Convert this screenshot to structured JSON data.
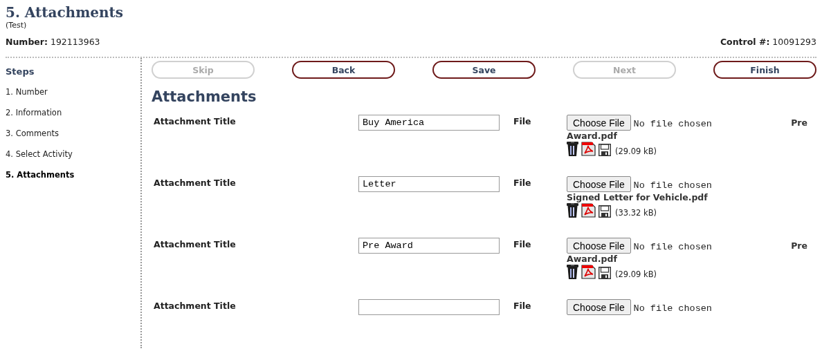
{
  "header": {
    "title": "5. Attachments",
    "subtitle": "(Test)",
    "number_label": "Number:",
    "number": "192113963",
    "control_label": "Control #:",
    "control": "10091293"
  },
  "steps": {
    "heading": "Steps",
    "items": [
      {
        "label": "1. Number",
        "selected": false
      },
      {
        "label": "2. Information",
        "selected": false
      },
      {
        "label": "3. Comments",
        "selected": false
      },
      {
        "label": "4. Select Activity",
        "selected": false
      },
      {
        "label": "5. Attachments",
        "selected": true
      }
    ]
  },
  "buttons": [
    {
      "label": "Skip",
      "disabled": true
    },
    {
      "label": "Back",
      "disabled": false
    },
    {
      "label": "Save",
      "disabled": false
    },
    {
      "label": "Next",
      "disabled": true
    },
    {
      "label": "Finish",
      "disabled": false
    }
  ],
  "section_title": "Attachments",
  "attachments": [
    {
      "title_label": "Attachment Title",
      "value": "Buy America",
      "file_label": "File",
      "choose_label": "Choose File",
      "no_file": "No file chosen",
      "file": {
        "name_lines": [
          "Pre",
          "Award.pdf"
        ],
        "size": "(29.09 kB)"
      }
    },
    {
      "title_label": "Attachment Title",
      "value": "Letter",
      "file_label": "File",
      "choose_label": "Choose File",
      "no_file": "No file chosen",
      "file": {
        "name_lines": [
          "Signed Letter for Vehicle.pdf"
        ],
        "size": "(33.32 kB)"
      }
    },
    {
      "title_label": "Attachment Title",
      "value": "Pre Award",
      "file_label": "File",
      "choose_label": "Choose File",
      "no_file": "No file chosen",
      "file": {
        "name_lines": [
          "Pre",
          "Award.pdf"
        ],
        "size": "(29.09 kB)"
      }
    },
    {
      "title_label": "Attachment Title",
      "file_label": "File",
      "choose_label": "Choose File",
      "no_file": "No file chosen"
    }
  ]
}
